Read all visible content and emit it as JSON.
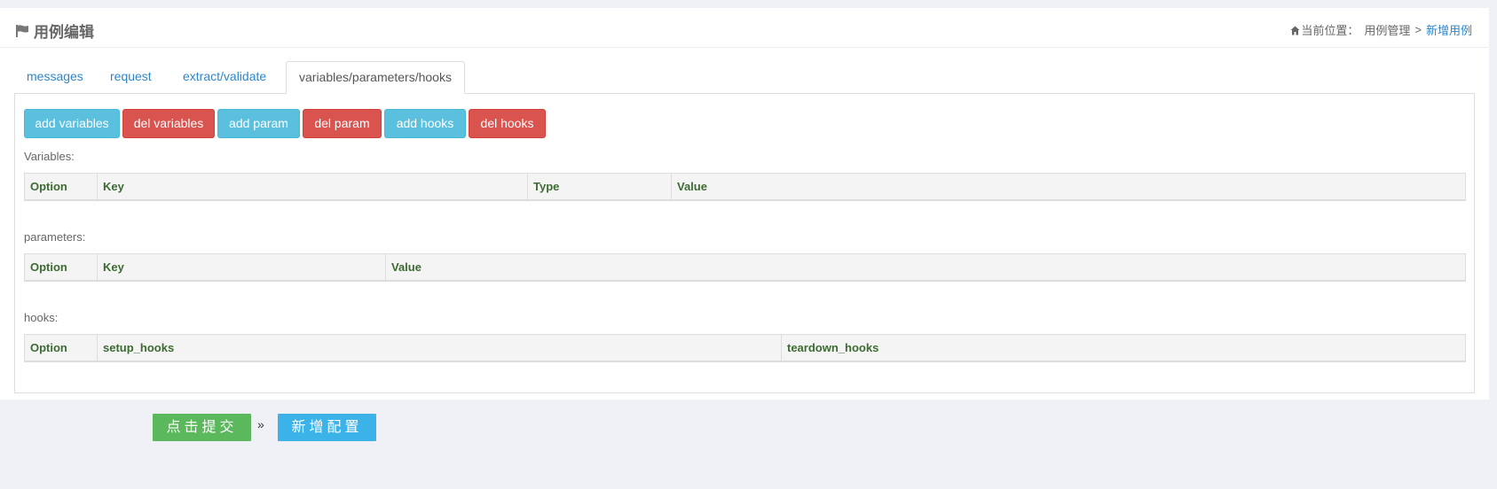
{
  "header": {
    "title": "用例编辑",
    "breadcrumb": {
      "prefix": "当前位置：",
      "parent": "用例管理",
      "separator": ">",
      "current": "新增用例"
    }
  },
  "tabs": [
    {
      "label": "messages",
      "active": false
    },
    {
      "label": "request",
      "active": false
    },
    {
      "label": "extract/validate",
      "active": false
    },
    {
      "label": "variables/parameters/hooks",
      "active": true
    }
  ],
  "toolbar": {
    "add_variables": "add variables",
    "del_variables": "del variables",
    "add_param": "add param",
    "del_param": "del param",
    "add_hooks": "add hooks",
    "del_hooks": "del hooks"
  },
  "variables": {
    "label": "Variables:",
    "columns": [
      "Option",
      "Key",
      "Type",
      "Value"
    ]
  },
  "parameters": {
    "label": "parameters:",
    "columns": [
      "Option",
      "Key",
      "Value"
    ]
  },
  "hooks": {
    "label": "hooks:",
    "columns": [
      "Option",
      "setup_hooks",
      "teardown_hooks"
    ]
  },
  "footer": {
    "submit_label": "点击提交",
    "arrow": "»",
    "add_config_label": "新增配置"
  },
  "colors": {
    "info": "#5bc0de",
    "danger": "#d9534f",
    "success": "#5cb85c",
    "link": "#2e86c9",
    "header_text": "#3c6b32"
  }
}
